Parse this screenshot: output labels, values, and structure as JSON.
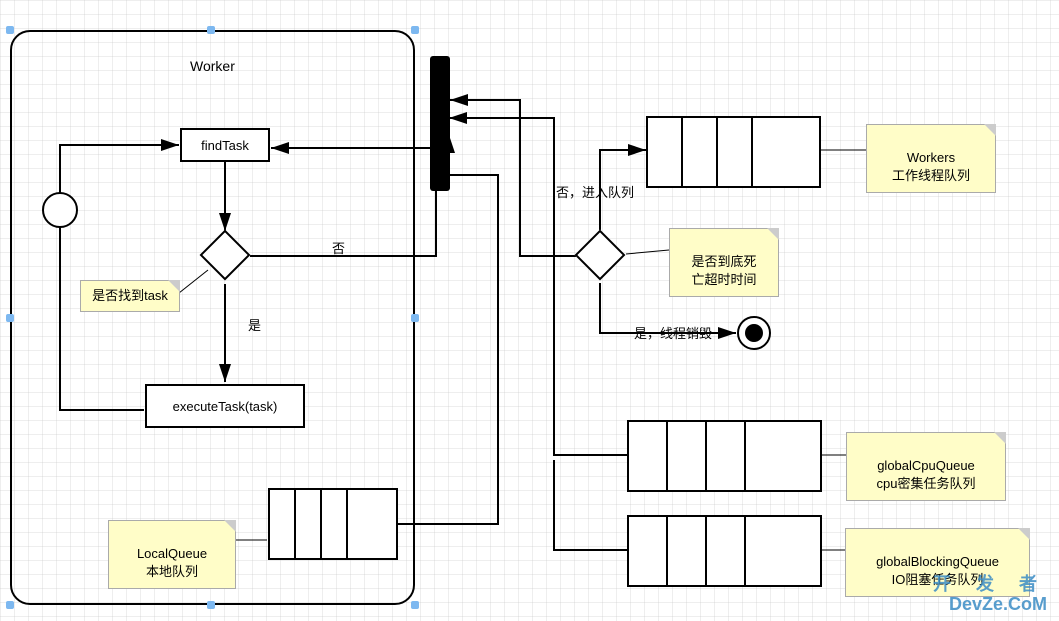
{
  "worker": {
    "frame_title": "Worker",
    "find_task": "findTask",
    "execute_task": "executeTask(task)",
    "decision_note": "是否找到task",
    "branch_yes": "是",
    "branch_no": "否",
    "local_queue_note": "LocalQueue\n本地队列"
  },
  "right": {
    "decision_note": "是否到底死\n亡超时时间",
    "branch_enter_queue": "否，进入队列",
    "branch_destroy": "是，线程销毁",
    "workers_note": "Workers\n工作线程队列",
    "cpu_queue_note": "globalCpuQueue\ncpu密集任务队列",
    "blocking_queue_note": "globalBlockingQueue\nIO阻塞任务队列"
  },
  "watermark": {
    "zh": "开 发 者",
    "en": "DevZe.CoM"
  }
}
